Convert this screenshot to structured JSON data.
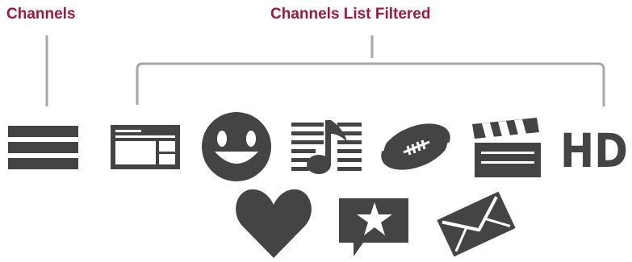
{
  "labels": {
    "channels": "Channels",
    "filtered": "Channels List Filtered"
  },
  "colors": {
    "label": "#9b1b3f",
    "icon": "#444444",
    "connector": "#a6a6a6",
    "background": "#ffffff"
  },
  "icons": {
    "row1": [
      "channels-menu-icon",
      "list-view-icon",
      "smiley-icon",
      "music-list-icon",
      "football-icon",
      "clapperboard-icon",
      "hd-icon"
    ],
    "row2": [
      "heart-icon",
      "star-speech-bubble-icon",
      "envelope-icon"
    ]
  },
  "hd_text": "HD"
}
